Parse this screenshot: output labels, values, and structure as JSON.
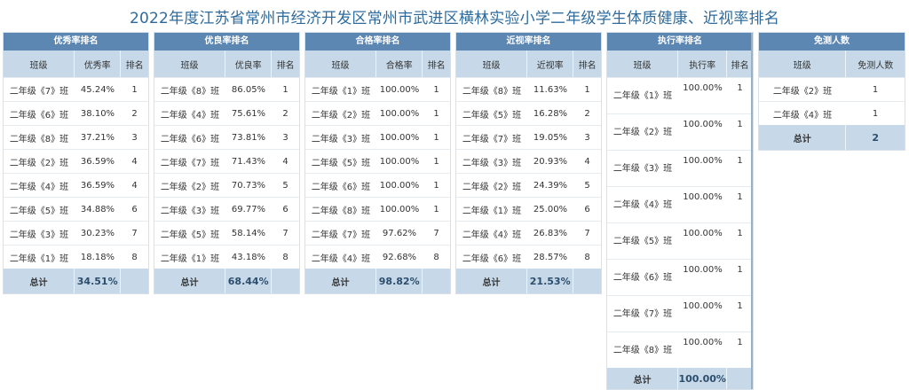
{
  "title": "2022年度江苏省常州市经济开发区常州市武进区横林实验小学二年级学生体质健康、近视率排名",
  "panels": [
    {
      "name": "优秀率排名",
      "headers": [
        "班级",
        "优秀率",
        "排名"
      ],
      "rows": [
        [
          "二年级《7》班",
          "45.24%",
          "1"
        ],
        [
          "二年级《6》班",
          "38.10%",
          "2"
        ],
        [
          "二年级《8》班",
          "37.21%",
          "3"
        ],
        [
          "二年级《2》班",
          "36.59%",
          "4"
        ],
        [
          "二年级《4》班",
          "36.59%",
          "4"
        ],
        [
          "二年级《5》班",
          "34.88%",
          "6"
        ],
        [
          "二年级《3》班",
          "30.23%",
          "7"
        ],
        [
          "二年级《1》班",
          "18.18%",
          "8"
        ]
      ],
      "total_label": "总计",
      "total_value": "34.51%"
    },
    {
      "name": "优良率排名",
      "headers": [
        "班级",
        "优良率",
        "排名"
      ],
      "rows": [
        [
          "二年级《8》班",
          "86.05%",
          "1"
        ],
        [
          "二年级《4》班",
          "75.61%",
          "2"
        ],
        [
          "二年级《6》班",
          "73.81%",
          "3"
        ],
        [
          "二年级《7》班",
          "71.43%",
          "4"
        ],
        [
          "二年级《2》班",
          "70.73%",
          "5"
        ],
        [
          "二年级《3》班",
          "69.77%",
          "6"
        ],
        [
          "二年级《5》班",
          "58.14%",
          "7"
        ],
        [
          "二年级《1》班",
          "43.18%",
          "8"
        ]
      ],
      "total_label": "总计",
      "total_value": "68.44%"
    },
    {
      "name": "合格率排名",
      "headers": [
        "班级",
        "合格率",
        "排名"
      ],
      "rows": [
        [
          "二年级《1》班",
          "100.00%",
          "1"
        ],
        [
          "二年级《2》班",
          "100.00%",
          "1"
        ],
        [
          "二年级《3》班",
          "100.00%",
          "1"
        ],
        [
          "二年级《5》班",
          "100.00%",
          "1"
        ],
        [
          "二年级《6》班",
          "100.00%",
          "1"
        ],
        [
          "二年级《8》班",
          "100.00%",
          "1"
        ],
        [
          "二年级《7》班",
          "97.62%",
          "7"
        ],
        [
          "二年级《4》班",
          "92.68%",
          "8"
        ]
      ],
      "total_label": "总计",
      "total_value": "98.82%"
    },
    {
      "name": "近视率排名",
      "headers": [
        "班级",
        "近视率",
        "排名"
      ],
      "rows": [
        [
          "二年级《8》班",
          "11.63%",
          "1"
        ],
        [
          "二年级《5》班",
          "16.28%",
          "2"
        ],
        [
          "二年级《7》班",
          "19.05%",
          "3"
        ],
        [
          "二年级《3》班",
          "20.93%",
          "4"
        ],
        [
          "二年级《2》班",
          "24.39%",
          "5"
        ],
        [
          "二年级《1》班",
          "25.00%",
          "6"
        ],
        [
          "二年级《4》班",
          "26.83%",
          "7"
        ],
        [
          "二年级《6》班",
          "28.57%",
          "8"
        ]
      ],
      "total_label": "总计",
      "total_value": "21.53%"
    },
    {
      "name": "执行率排名",
      "headers": [
        "班级",
        "执行率",
        "排名"
      ],
      "rows": [
        [
          "二年级《1》班",
          "100.00%",
          "1"
        ],
        [
          "二年级《2》班",
          "100.00%",
          "1"
        ],
        [
          "二年级《3》班",
          "100.00%",
          "1"
        ],
        [
          "二年级《4》班",
          "100.00%",
          "1"
        ],
        [
          "二年级《5》班",
          "100.00%",
          "1"
        ],
        [
          "二年级《6》班",
          "100.00%",
          "1"
        ],
        [
          "二年级《7》班",
          "100.00%",
          "1"
        ],
        [
          "二年级《8》班",
          "100.00%",
          "1"
        ]
      ],
      "total_label": "总计",
      "total_value": "100.00%"
    },
    {
      "name": "免测人数",
      "headers": [
        "班级",
        "免测人数"
      ],
      "rows": [
        [
          "二年级《2》班",
          "1"
        ],
        [
          "二年级《4》班",
          "1"
        ]
      ],
      "total_label": "总计",
      "total_value": "2"
    }
  ]
}
